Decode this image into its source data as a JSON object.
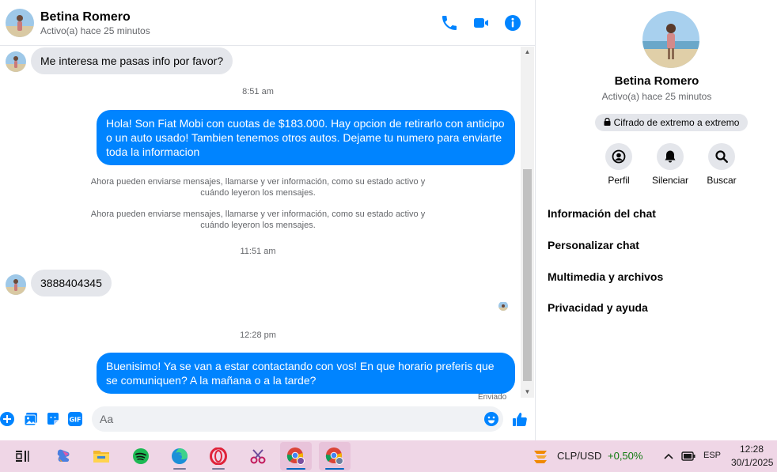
{
  "contact": {
    "name": "Betina Romero",
    "status": "Activo(a) hace 25 minutos"
  },
  "header_icons": [
    "phone-icon",
    "video-call-icon",
    "info-icon"
  ],
  "messages": {
    "m1": "Me interesa me pasas info por favor?",
    "ts1": "8:51 am",
    "m2": "Hola! Son Fiat Mobi con cuotas de $183.000. Hay opcion de retirarlo con anticipo o un auto usado! Tambien tenemos otros autos. Dejame tu numero para enviarte toda la informacion",
    "sys1": "Ahora pueden enviarse mensajes, llamarse y ver información, como su estado activo y cuándo leyeron los mensajes.",
    "sys2": "Ahora pueden enviarse mensajes, llamarse y ver información, como su estado activo y cuándo leyeron los mensajes.",
    "ts2": "11:51 am",
    "m3": "3888404345",
    "ts3": "12:28 pm",
    "m4": "Buenisimo! Ya se van a estar contactando con vos! En que horario preferis que se comuniquen? A la mañana o a la tarde?",
    "delivery": "Enviado"
  },
  "composer": {
    "placeholder": "Aa"
  },
  "side_panel": {
    "name": "Betina Romero",
    "status": "Activo(a) hace 25 minutos",
    "encryption": "Cifrado de extremo a extremo",
    "actions": [
      {
        "label": "Perfil",
        "icon": "profile-icon"
      },
      {
        "label": "Silenciar",
        "icon": "bell-icon"
      },
      {
        "label": "Buscar",
        "icon": "search-icon"
      }
    ],
    "menu": [
      "Información del chat",
      "Personalizar chat",
      "Multimedia y archivos",
      "Privacidad y ayuda"
    ]
  },
  "taskbar": {
    "ticker_name": "CLP/USD",
    "ticker_value": "+0,50%",
    "lang": "ESP",
    "time": "12:28",
    "date": "30/1/2025"
  },
  "colors": {
    "brand": "#0084ff",
    "incoming_bubble": "#e4e6eb",
    "taskbar": "#efd6e6",
    "positive": "#0f7b0f"
  }
}
